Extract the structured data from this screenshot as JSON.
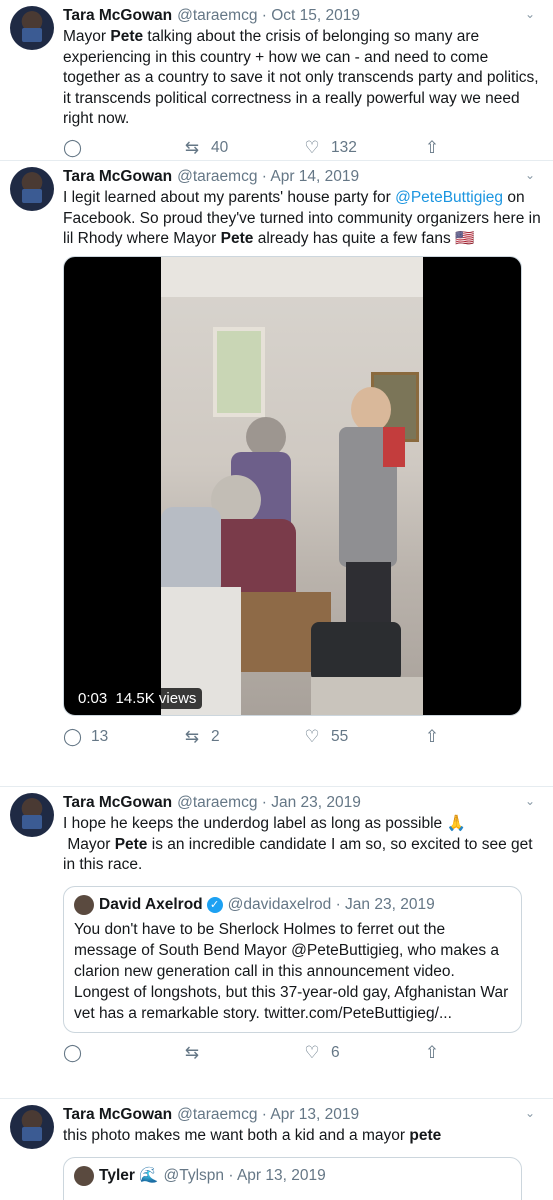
{
  "tweets": [
    {
      "name": "Tara McGowan",
      "handle": "@taraemcg · Oct 15, 2019",
      "text_parts": [
        "Mayor ",
        "Pete",
        " talking about the crisis of belonging so many are experiencing in this country + how we can - and need to come together as a country to save it not only transcends party and politics, it transcends political correctness in a really powerful way we need right now."
      ],
      "reply_count": "",
      "retweet_count": "40",
      "like_count": "132"
    },
    {
      "name": "Tara McGowan",
      "handle": "@taraemcg · Apr 14, 2019",
      "text_parts": [
        "I legit learned about my parents' house party for ",
        "@PeteButtigieg",
        " on Facebook. So proud they've turned into community organizers here in lil Rhody where Mayor ",
        "Pete",
        " already has quite a few fans 🇺🇸"
      ],
      "video": {
        "time": "0:03",
        "views": "14.5K views"
      },
      "reply_count": "13",
      "retweet_count": "2",
      "like_count": "55"
    },
    {
      "name": "Tara McGowan",
      "handle": "@taraemcg · Jan 23, 2019",
      "text_parts": [
        "I hope he keeps the underdog label as long as possible 🙏",
        "Mayor ",
        "Pete",
        " is an incredible candidate I am so, so excited to see get in this race."
      ],
      "quote": {
        "name": "David Axelrod",
        "handle": "@davidaxelrod · Jan 23, 2019",
        "text": "You don't have to be Sherlock Holmes to ferret out the message of South Bend Mayor @PeteButtigieg, who makes a clarion new generation call in this announcement video.  Longest of longshots, but this 37-year-old gay, Afghanistan War vet has a remarkable story. twitter.com/PeteButtigieg/..."
      },
      "reply_count": "",
      "retweet_count": "",
      "like_count": "6"
    },
    {
      "name": "Tara McGowan",
      "handle": "@taraemcg · Apr 13, 2019",
      "text_parts": [
        "this photo makes me want both a kid and a mayor ",
        "pete"
      ],
      "quote": {
        "name": "Tyler 🌊",
        "handle": "@Tylspn · Apr 13, 2019"
      }
    }
  ],
  "icons": {
    "reply": "reply-icon",
    "retweet": "retweet-icon",
    "like": "like-icon",
    "share": "share-icon",
    "more": "chevron-down-icon"
  },
  "colors": {
    "link": "#1b95e0",
    "muted": "#657786",
    "verified": "#1da1f2"
  }
}
